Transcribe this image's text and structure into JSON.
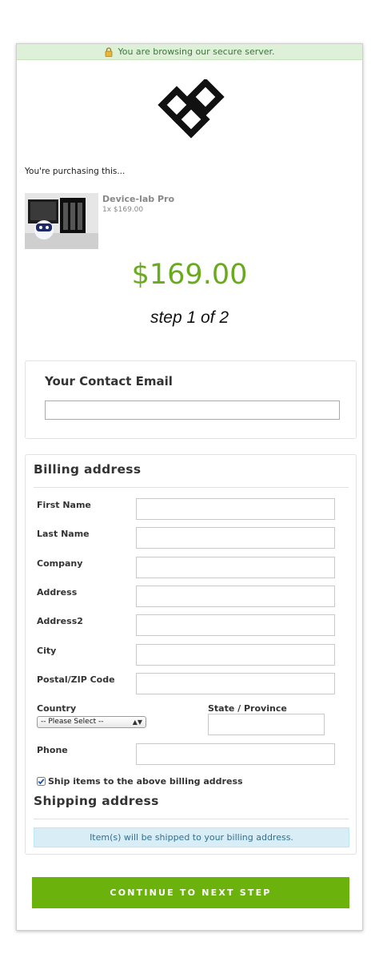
{
  "secure_bar": {
    "icon": "lock-icon",
    "text": "You are browsing our secure server."
  },
  "logo": {
    "icon": "brand-logo-diamond"
  },
  "purchase": {
    "label": "You're purchasing this...",
    "product_name": "Device-lab Pro",
    "product_qty": "1x $169.00",
    "total": "$169.00"
  },
  "step": {
    "text": "step 1 of 2"
  },
  "contact": {
    "title": "Your Contact Email",
    "email_value": ""
  },
  "billing": {
    "title": "Billing address",
    "fields": {
      "first_name": "First Name",
      "last_name": "Last Name",
      "company": "Company",
      "address": "Address",
      "address2": "Address2",
      "city": "City",
      "postal": "Postal/ZIP Code",
      "country": "Country",
      "state": "State / Province",
      "phone": "Phone"
    },
    "country_selected": "-- Please Select --",
    "ship_to_billing_label": "Ship items to the above billing address",
    "ship_to_billing_checked": true
  },
  "shipping": {
    "title": "Shipping address",
    "notice": "Item(s) will be shipped to your billing address."
  },
  "actions": {
    "continue_label": "CONTINUE TO NEXT STEP"
  },
  "colors": {
    "accent_green": "#6bb30c",
    "price_green": "#6aaa1e",
    "secure_bg": "#dff0d8",
    "notice_bg": "#d9edf7"
  }
}
